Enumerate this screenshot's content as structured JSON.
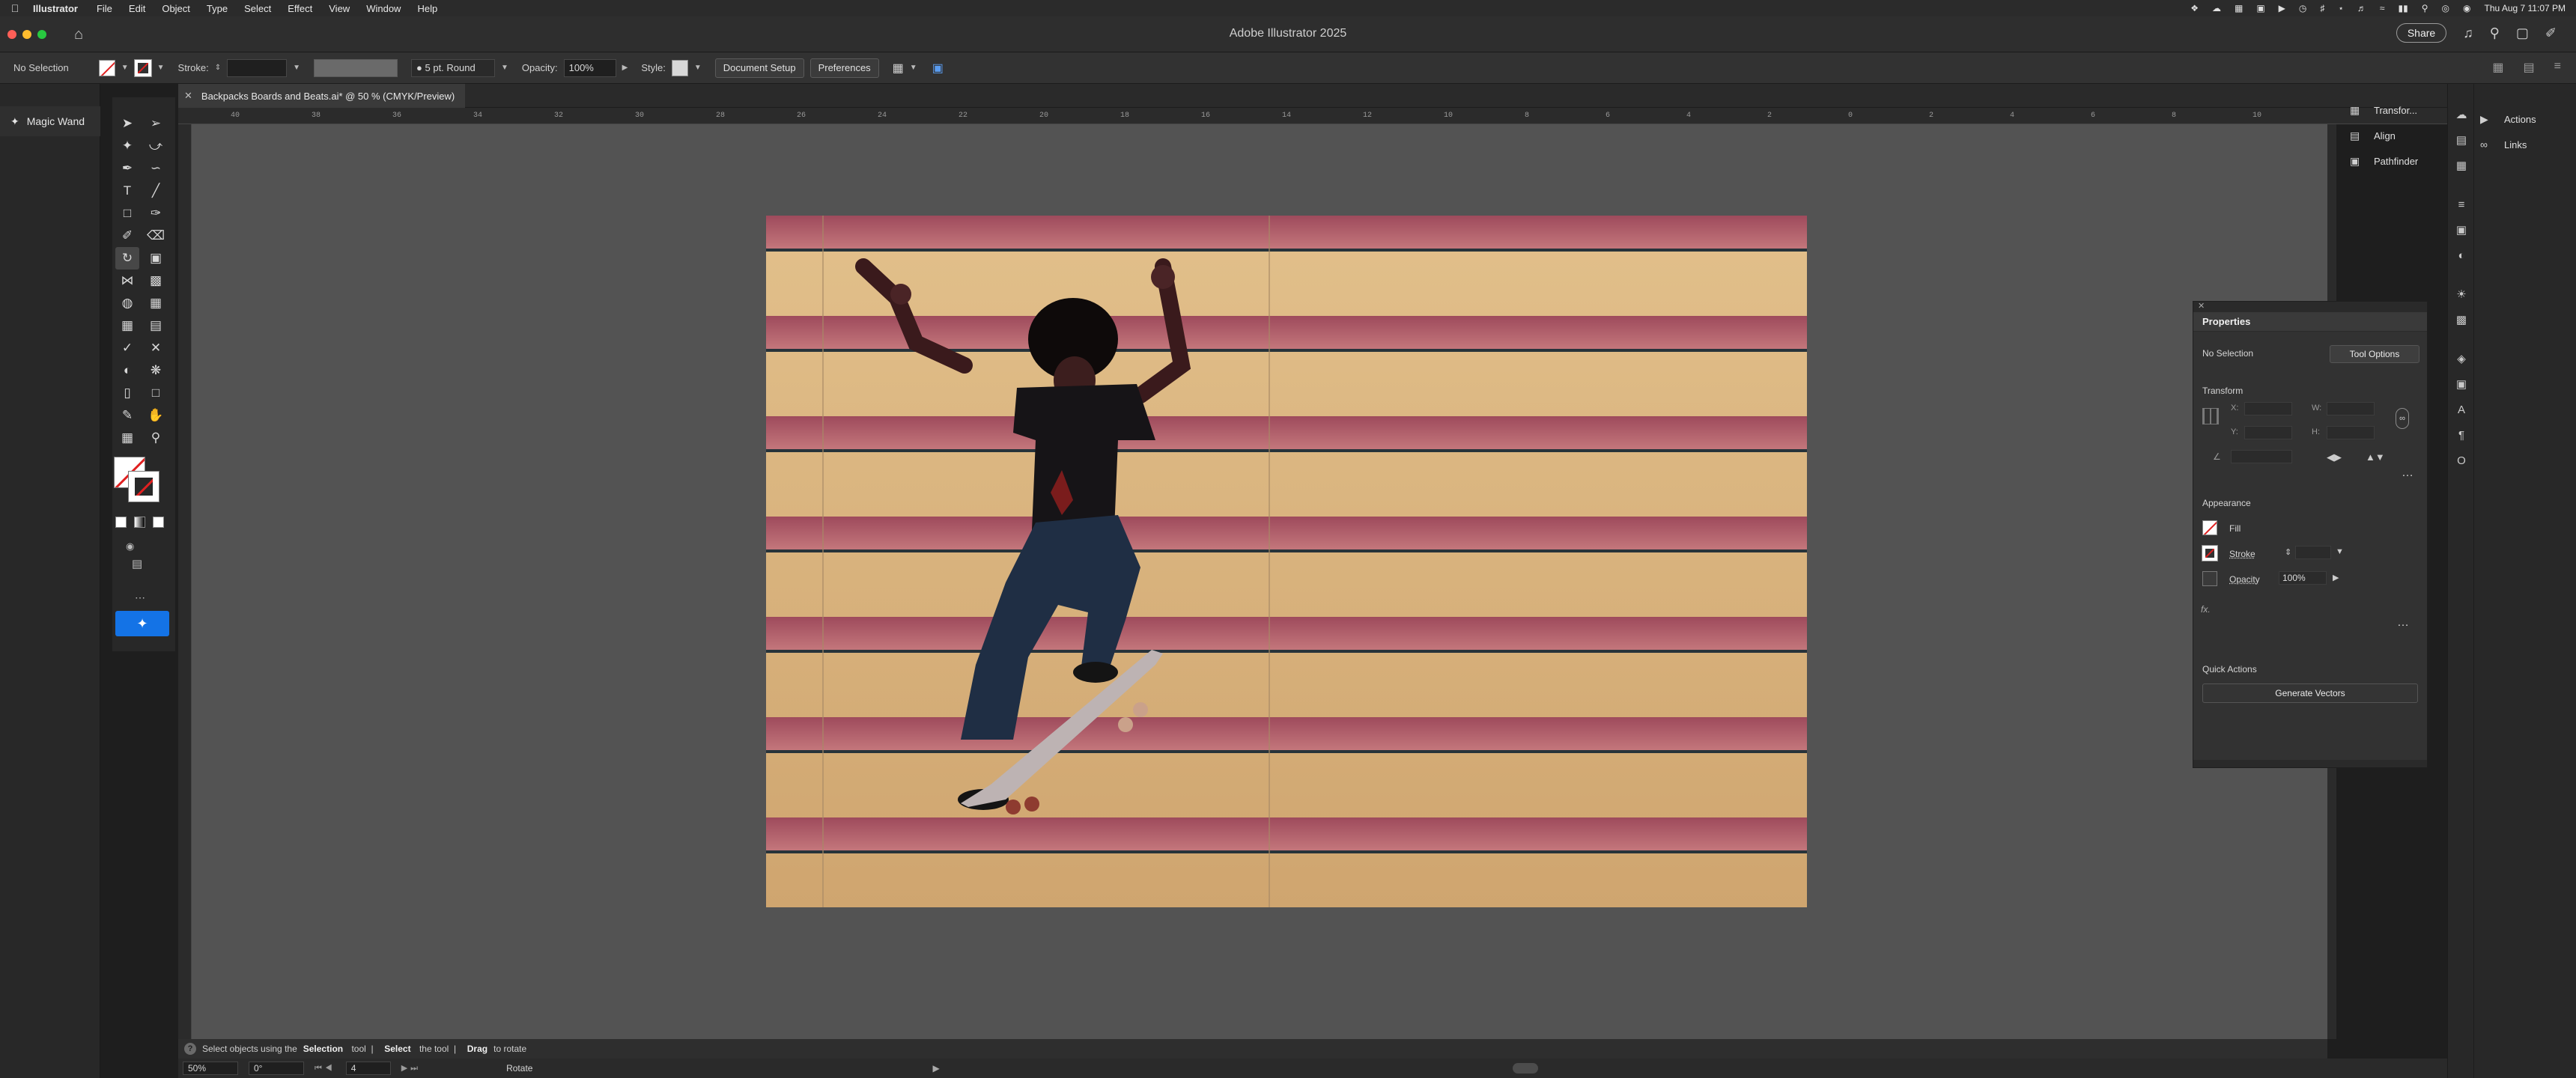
{
  "menubar": {
    "app_name": "Illustrator",
    "items": [
      "File",
      "Edit",
      "Object",
      "Type",
      "Select",
      "Effect",
      "View",
      "Window",
      "Help"
    ],
    "clock": "Thu Aug 7  11:07 PM"
  },
  "titlebar": {
    "title": "Adobe Illustrator 2025",
    "share_label": "Share"
  },
  "controlbar": {
    "selection_label": "No Selection",
    "stroke_label": "Stroke:",
    "brush_label": "5 pt. Round",
    "opacity_label": "Opacity:",
    "opacity_value": "100%",
    "style_label": "Style:",
    "document_setup_label": "Document Setup",
    "preferences_label": "Preferences"
  },
  "left_dock": {
    "magic_wand_label": "Magic Wand"
  },
  "document": {
    "tab_title": "Backpacks Boards and Beats.ai* @ 50 % (CMYK/Preview)",
    "ruler_ticks": [
      "40",
      "38",
      "36",
      "34",
      "32",
      "30",
      "28",
      "26",
      "24",
      "22",
      "20",
      "18",
      "16",
      "14",
      "12",
      "10",
      "8",
      "6",
      "4",
      "2",
      "0",
      "2",
      "4",
      "6",
      "8",
      "10"
    ]
  },
  "status": {
    "hint_parts": [
      "Select objects using the ",
      "Selection",
      " tool  |  ",
      "Select",
      " the tool  |  ",
      "Drag",
      " to rotate"
    ],
    "zoom": "50%",
    "rotation": "0°",
    "artboard_num": "4",
    "mode_label": "Rotate"
  },
  "right_panels": {
    "collapsed": [
      {
        "icon": "transform-icon",
        "label": "Transfor..."
      },
      {
        "icon": "align-icon",
        "label": "Align"
      },
      {
        "icon": "pathfinder-icon",
        "label": "Pathfinder"
      }
    ],
    "far_right": [
      {
        "icon": "play-icon",
        "label": "Actions"
      },
      {
        "icon": "link-icon",
        "label": "Links"
      }
    ]
  },
  "properties": {
    "tab_title": "Properties",
    "selection_text": "No Selection",
    "tool_options_label": "Tool Options",
    "transform_title": "Transform",
    "x_label": "X:",
    "y_label": "Y:",
    "w_label": "W:",
    "h_label": "H:",
    "appearance_title": "Appearance",
    "fill_label": "Fill",
    "stroke_label": "Stroke",
    "opacity_label": "Opacity",
    "opacity_value": "100%",
    "fx_label": "fx.",
    "quick_actions_title": "Quick Actions",
    "generate_vectors_label": "Generate Vectors"
  },
  "colors": {
    "accent": "#1473e6",
    "stripe_pink": "#b8616e",
    "stripe_tan": "#d9b47e",
    "stair_edge": "#27333a"
  }
}
